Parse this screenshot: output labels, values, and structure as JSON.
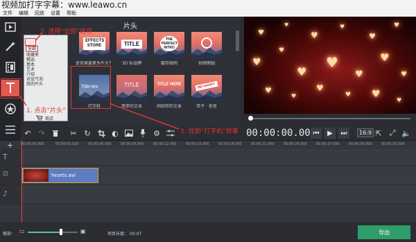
{
  "watermark": "视频加打字字幕：www.leawo.cn",
  "menu": [
    "文件",
    "编辑",
    "回放",
    "设置",
    "帮助"
  ],
  "left_tools": [
    {
      "icon": "import-media-icon"
    },
    {
      "icon": "magic-wand-icon"
    },
    {
      "icon": "film-strip-icon"
    },
    {
      "icon": "text-title-icon",
      "active": true
    },
    {
      "icon": "sticker-star-icon"
    },
    {
      "icon": "more-menu-icon"
    }
  ],
  "library": {
    "header": "片头",
    "categories": [
      "全部",
      "收藏夹",
      "精选",
      "基本",
      "艺术",
      "介绍",
      "对话气泡",
      "我的片头"
    ],
    "footer_label": "商店",
    "items": [
      {
        "badge": "EFFECTS STORE",
        "caption": "是否需要更多片头？"
      },
      {
        "badge": "TITLE",
        "caption": "3D 标语牌"
      },
      {
        "badge": "THE PERFECT INTRO",
        "caption": "缓存剧闹"
      },
      {
        "badge": "",
        "caption": "视频图圈"
      },
      {
        "badge": "Title tex",
        "caption": "打字机"
      },
      {
        "badge": "TITLE",
        "caption": "简单的文本"
      },
      {
        "badge": "TITLE HERE",
        "caption": "闹绕你的文本"
      },
      {
        "badge": "BE HAPPY",
        "caption": "带子 · 星星"
      }
    ]
  },
  "annotations": {
    "step1": "1. 点击“片头”",
    "step2": "2. 选择“全部”选项",
    "step3": "3. 找到“打字机”效果"
  },
  "player": {
    "timecode": "00:00:00.000",
    "aspect": "16:9"
  },
  "timeline": {
    "ticks": [
      "00:00:00.000",
      "00:00:03.000",
      "00:00:06.000",
      "00:00:09.000",
      "00:00:12.000",
      "00:00:15.000",
      "00:00:18.000",
      "00:00:21.000",
      "00:00:24.000",
      "00:00:27.000",
      "00:00:30.000",
      "00:00:33.000"
    ],
    "clip_name": "hearts.avi"
  },
  "bottom": {
    "zoom_label": "缩放：",
    "zoom_level": 0.66,
    "project_length": "项目长度：  00:07",
    "export_label": "导出"
  },
  "colors": {
    "accent_red": "#e05a50",
    "export_green": "#2f9d6a",
    "clip_blue": "#5d7cc2"
  }
}
